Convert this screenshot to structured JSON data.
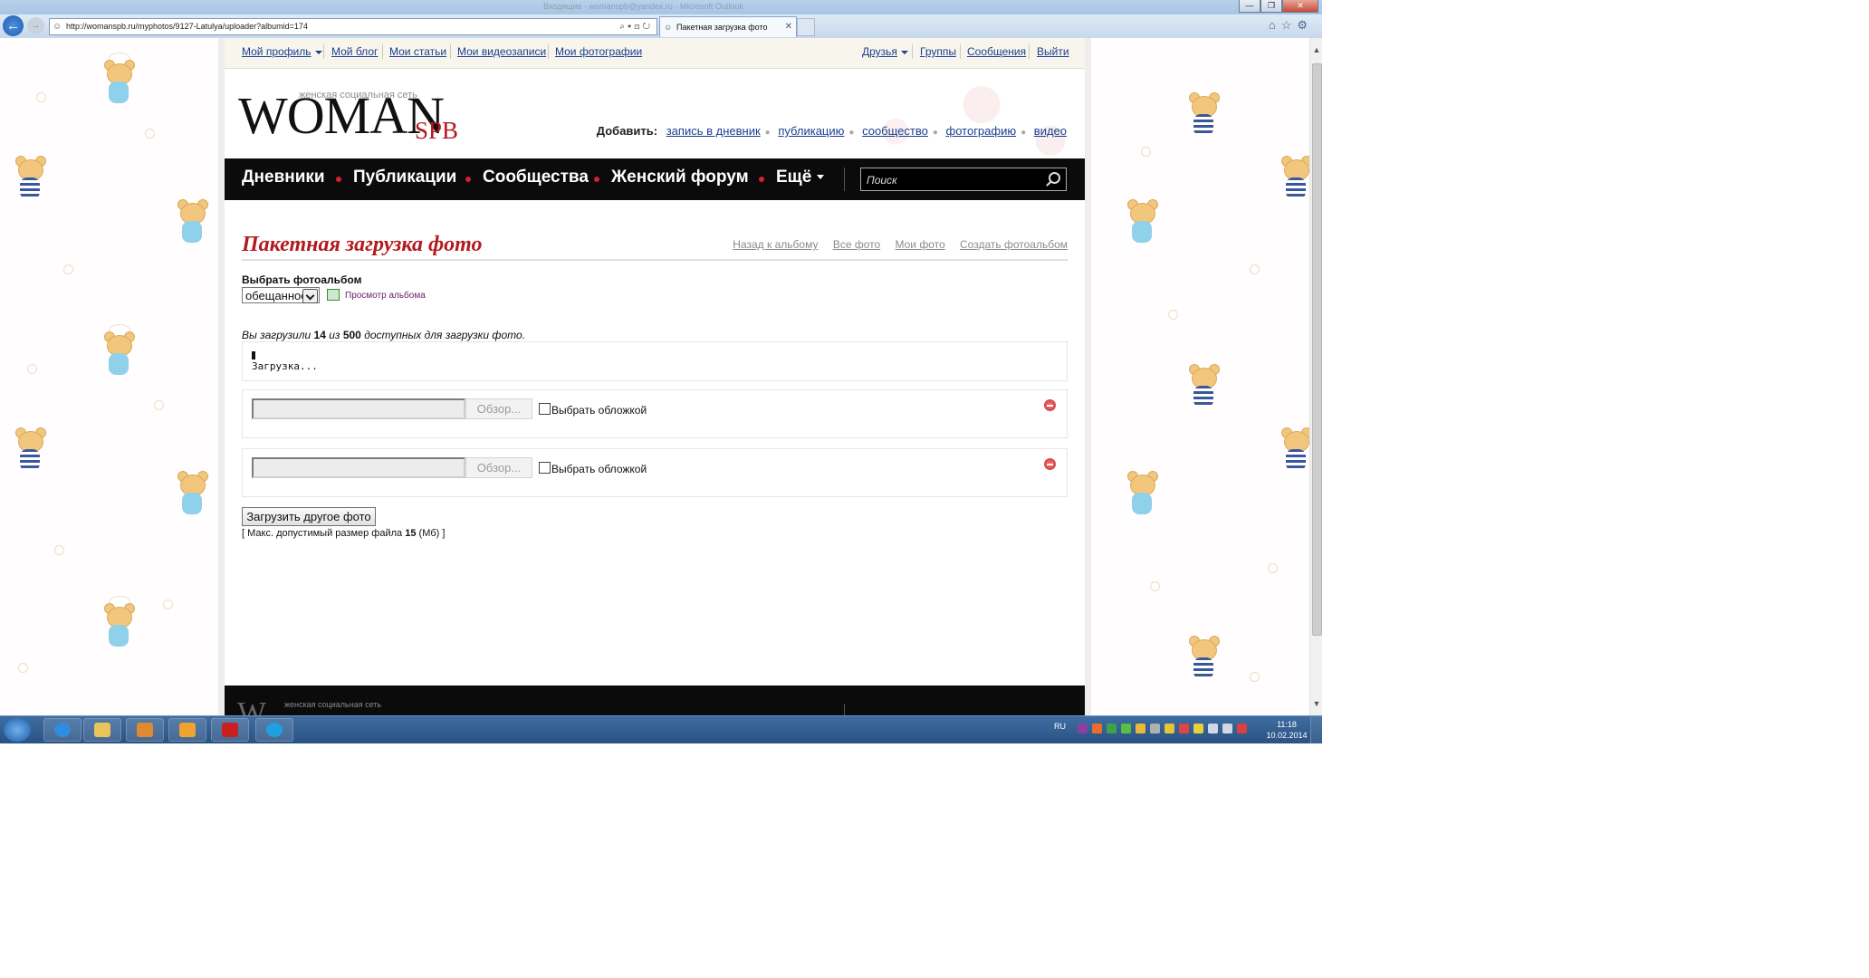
{
  "browser": {
    "window_title": "Входящие - womanspb@yandex.ru - Microsoft Outlook",
    "url": "http://womanspb.ru/myphotos/9127-Latulya/uploader?albumid=174",
    "tab_title": "Пакетная загрузка фото"
  },
  "top_nav": {
    "left": [
      "Мой профиль",
      "Мой блог",
      "Мои статьи",
      "Мои видеозаписи",
      "Мои фотографии"
    ],
    "right": [
      "Друзья",
      "Группы",
      "Сообщения",
      "Выйти"
    ]
  },
  "logo": {
    "tagline": "женская социальная сеть",
    "main": "WOMAN",
    "suffix": "SPB"
  },
  "add_bar": {
    "label": "Добавить:",
    "links": [
      "запись в дневник",
      "публикацию",
      "сообщество",
      "фотографию",
      "видео"
    ]
  },
  "main_menu": {
    "items": [
      "Дневники",
      "Публикации",
      "Сообщества",
      "Женский форум",
      "Ещё"
    ],
    "search_placeholder": "Поиск"
  },
  "page": {
    "title": "Пакетная загрузка фото",
    "links": [
      "Назад к альбому",
      "Все фото",
      "Мои фото",
      "Создать фотоальбом"
    ],
    "album_label": "Выбрать фотоальбом",
    "album_selected": "обещанное",
    "view_album": "Просмотр альбома",
    "stat_prefix": "Вы загрузили",
    "stat_uploaded": "14",
    "stat_mid": "из",
    "stat_total": "500",
    "stat_suffix": "доступных для загрузки фото.",
    "loading_text": "Загрузка...",
    "browse_label": "Обзор...",
    "cover_label": "Выбрать обложкой",
    "upload_another": "Загрузить другое фото",
    "max_size_prefix": "[ Макс. допустимый размер файла",
    "max_size_value": "15",
    "max_size_suffix": "(Мб) ]"
  },
  "footer": {
    "logo": "W",
    "tagline": "женская социальная сеть"
  },
  "taskbar": {
    "lang": "RU",
    "time": "11:18",
    "date": "10.02.2014"
  }
}
